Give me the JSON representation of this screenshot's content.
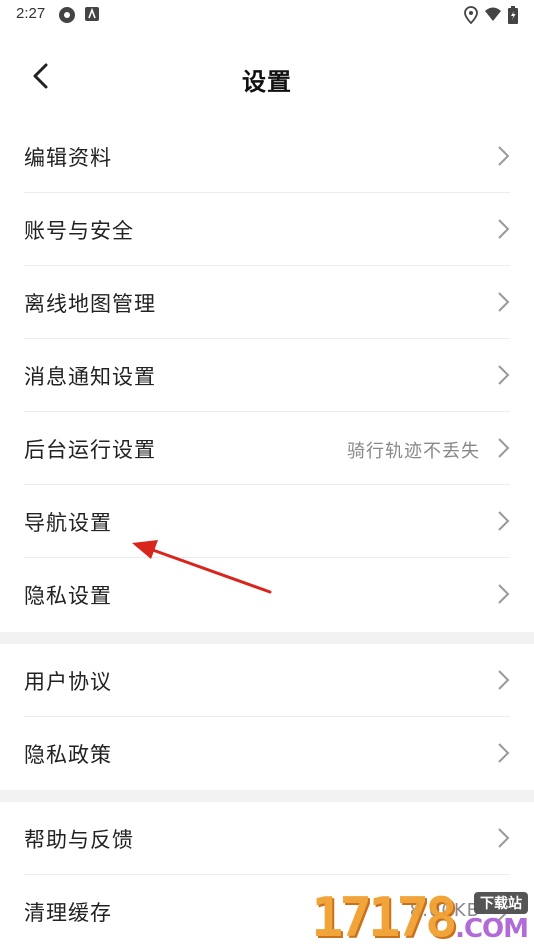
{
  "status_bar": {
    "time": "2:27"
  },
  "header": {
    "title": "设置",
    "back_icon": "chevron-left-icon"
  },
  "groups": [
    {
      "items": [
        {
          "label": "编辑资料",
          "value": ""
        },
        {
          "label": "账号与安全",
          "value": ""
        },
        {
          "label": "离线地图管理",
          "value": ""
        },
        {
          "label": "消息通知设置",
          "value": ""
        },
        {
          "label": "后台运行设置",
          "value": "骑行轨迹不丢失"
        },
        {
          "label": "导航设置",
          "value": ""
        },
        {
          "label": "隐私设置",
          "value": ""
        }
      ]
    },
    {
      "items": [
        {
          "label": "用户协议",
          "value": ""
        },
        {
          "label": "隐私政策",
          "value": ""
        }
      ]
    },
    {
      "items": [
        {
          "label": "帮助与反馈",
          "value": ""
        },
        {
          "label": "清理缓存",
          "value": "8.00KB"
        }
      ]
    }
  ],
  "watermark": {
    "digits": "17178",
    "tag": "下载站",
    "domain": ".COM"
  },
  "colors": {
    "annotation_arrow": "#d8261e",
    "background": "#f2f2f2",
    "secondary_text": "#888888"
  }
}
